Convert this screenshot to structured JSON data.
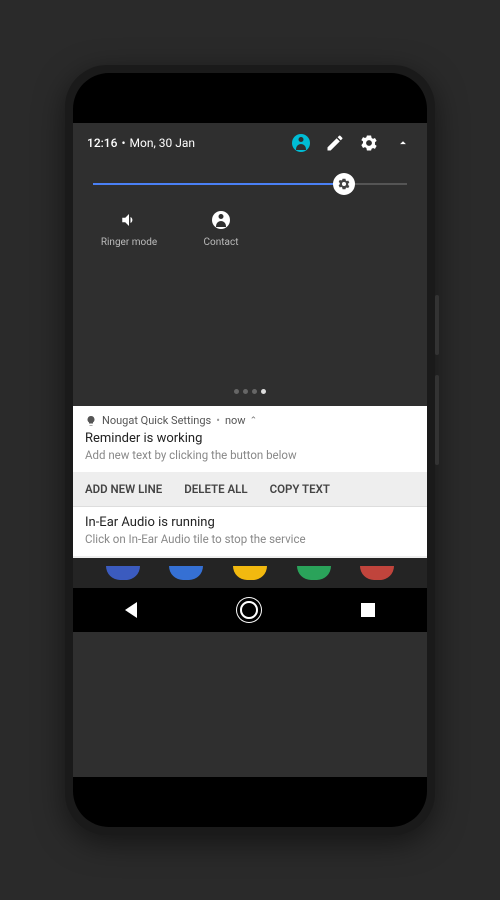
{
  "status": {
    "time": "12:16",
    "date": "Mon, 30 Jan"
  },
  "brightness": {
    "percent": 80
  },
  "tiles": [
    {
      "label": "Ringer mode",
      "icon": "volume-icon"
    },
    {
      "label": "Contact",
      "icon": "contact-icon"
    }
  ],
  "pager": {
    "count": 4,
    "active": 3
  },
  "notifications": [
    {
      "app": "Nougat Quick Settings",
      "when": "now",
      "title": "Reminder is working",
      "subtitle": "Add new text by clicking the button below",
      "actions": [
        "ADD NEW LINE",
        "DELETE ALL",
        "COPY TEXT"
      ]
    },
    {
      "title": "In-Ear Audio is running",
      "subtitle": "Click on In-Ear Audio tile to stop the service"
    }
  ],
  "apps_row_colors": [
    "#3b5bbf",
    "#3570d4",
    "#f2b90f",
    "#2aa35a",
    "#c0443c"
  ]
}
